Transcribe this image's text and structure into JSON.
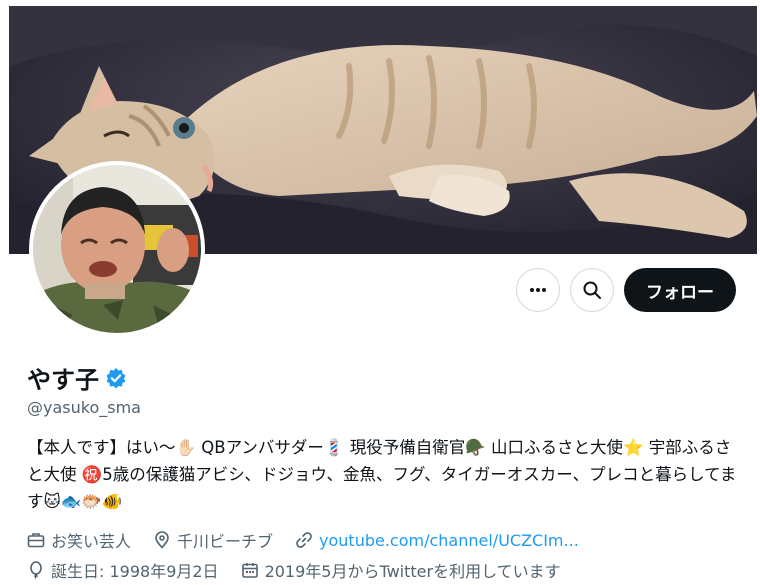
{
  "profile": {
    "name": "やす子",
    "handle": "@yasuko_sma",
    "verified": true,
    "verified_color": "#1d9bf0",
    "bio": "【本人です】はい〜✋🏻 QBアンバサダー💈 現役予備自衛官🪖 山口ふるさと大使⭐ 宇部ふるさと大使 ㊗️5歳の保護猫アビシ、ドジョウ、金魚、フグ、タイガーオスカー、プレコと暮らしてます🐱🐟🐡🐠"
  },
  "actions": {
    "more_icon": "more-horizontal-icon",
    "search_icon": "search-icon",
    "follow_label": "フォロー"
  },
  "meta": {
    "profession": "お笑い芸人",
    "location": "千川ビーチブ",
    "url": "youtube.com/channel/UCZCIm...",
    "birthday": "誕生日: 1998年9月2日",
    "joined": "2019年5月からTwitterを利用しています"
  },
  "colors": {
    "follow_bg": "#0f1419",
    "link": "#1d9bf0",
    "secondary_text": "#536471"
  }
}
